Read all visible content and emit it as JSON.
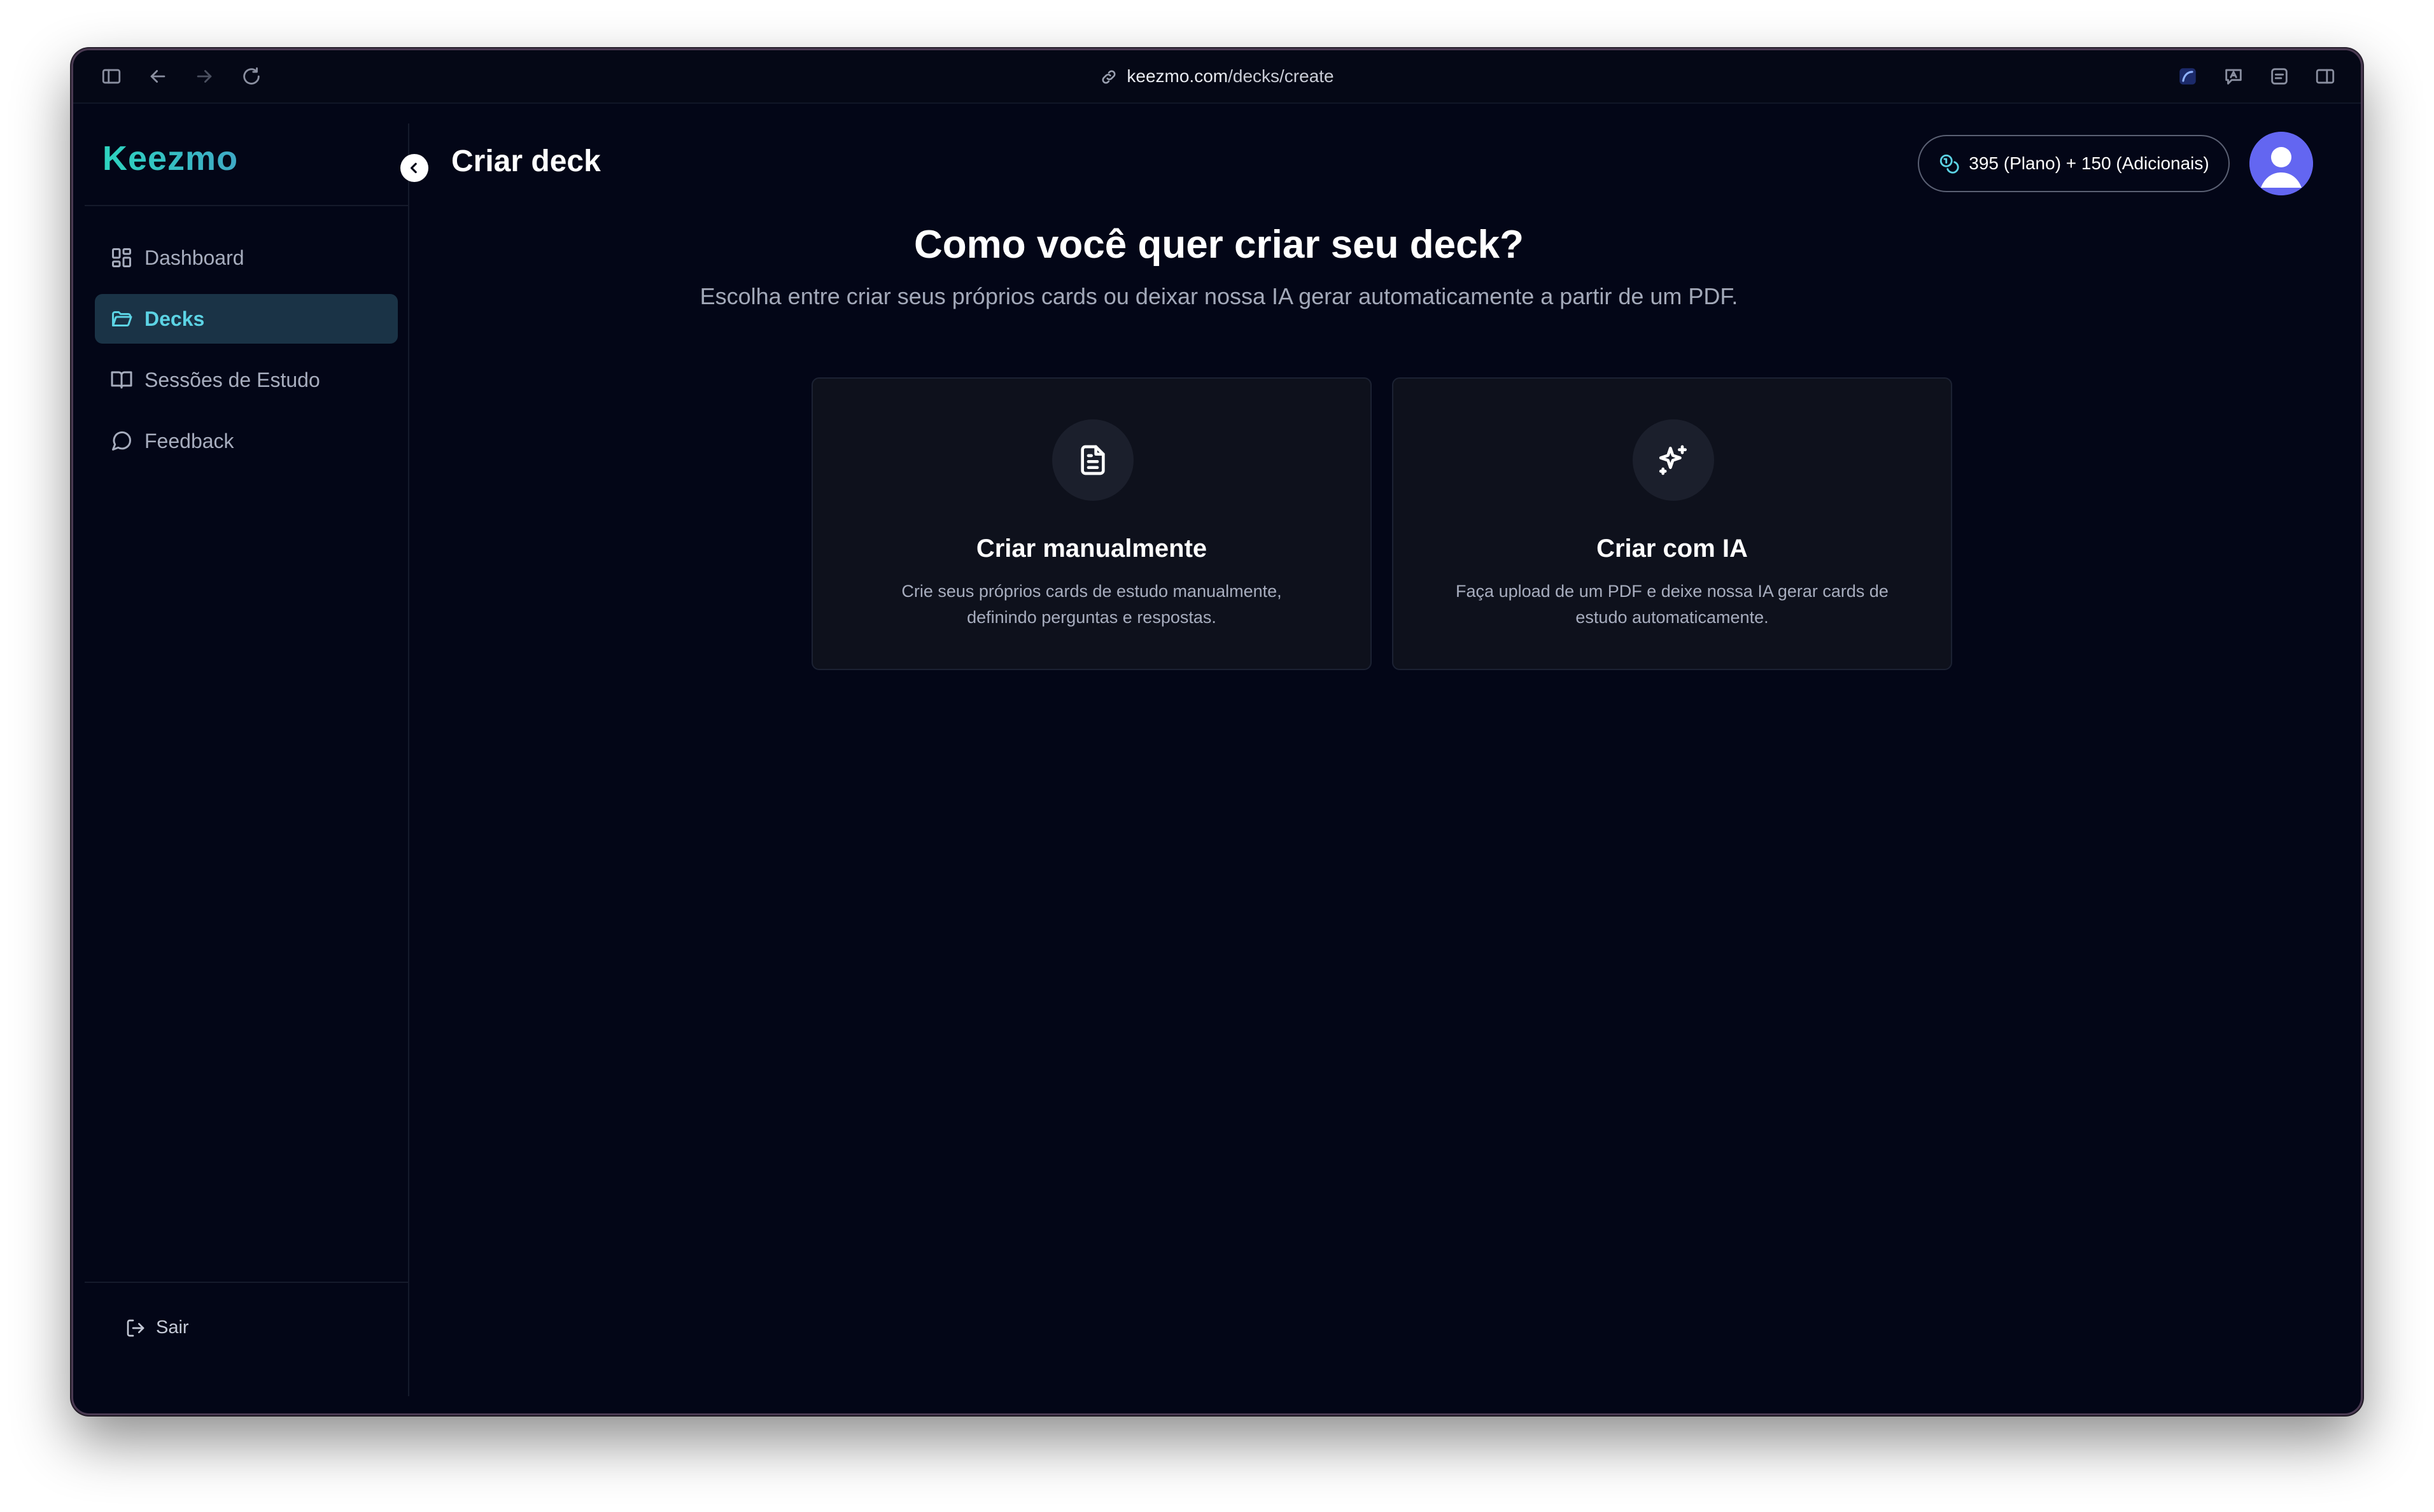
{
  "browser": {
    "url_host": "keezmo.com",
    "url_path": "/decks/create"
  },
  "sidebar": {
    "logo": "Keezmo",
    "items": [
      {
        "label": "Dashboard",
        "icon": "dashboard-icon",
        "active": false
      },
      {
        "label": "Decks",
        "icon": "folder-icon",
        "active": true
      },
      {
        "label": "Sessões de Estudo",
        "icon": "book-open-icon",
        "active": false
      },
      {
        "label": "Feedback",
        "icon": "message-circle-icon",
        "active": false
      }
    ],
    "logout_label": "Sair"
  },
  "header": {
    "title": "Criar deck",
    "credits": "395 (Plano) + 150 (Adicionais)"
  },
  "main": {
    "title": "Como você quer criar seu deck?",
    "subtitle": "Escolha entre criar seus próprios cards ou deixar nossa IA gerar automaticamente a partir de um PDF.",
    "options": [
      {
        "title": "Criar manualmente",
        "description": "Crie seus próprios cards de estudo manualmente, definindo perguntas e respostas.",
        "icon": "file-text-icon"
      },
      {
        "title": "Criar com IA",
        "description": "Faça upload de um PDF e deixe nossa IA gerar cards de estudo automaticamente.",
        "icon": "sparkles-icon"
      }
    ]
  },
  "colors": {
    "background": "#030617",
    "accent": "#5cd3e4",
    "active_nav_bg": "#1a3346",
    "avatar": "#6366f1"
  }
}
